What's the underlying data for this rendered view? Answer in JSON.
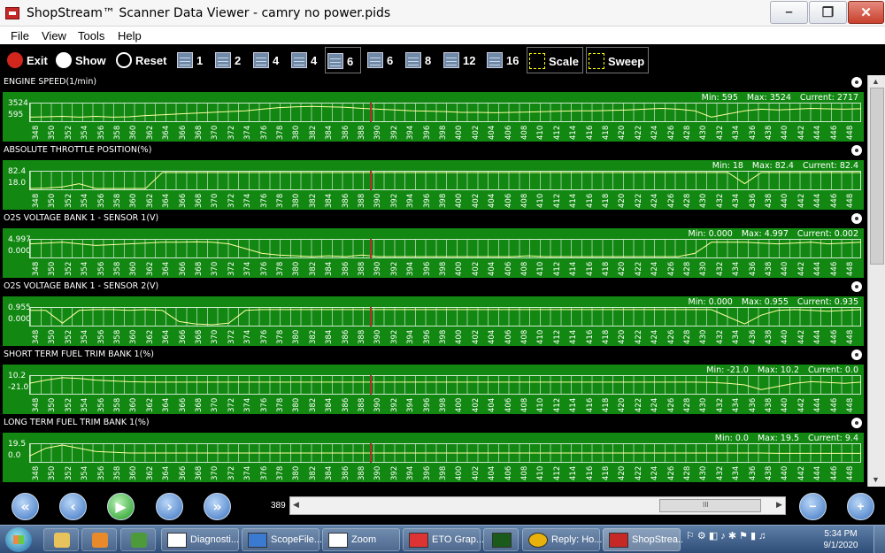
{
  "window": {
    "title": "ShopStream™ Scanner Data Viewer - camry no power.pids"
  },
  "menu": [
    "File",
    "View",
    "Tools",
    "Help"
  ],
  "toolbar": {
    "exit": "Exit",
    "show": "Show",
    "reset": "Reset",
    "layouts": [
      "1",
      "2",
      "4",
      "4",
      "6",
      "6",
      "8",
      "12",
      "16"
    ],
    "scale": "Scale",
    "sweep": "Sweep"
  },
  "x_ticks": [
    "348",
    "350",
    "352",
    "354",
    "356",
    "358",
    "360",
    "362",
    "364",
    "366",
    "368",
    "370",
    "372",
    "374",
    "376",
    "378",
    "380",
    "382",
    "384",
    "386",
    "388",
    "390",
    "392",
    "394",
    "396",
    "398",
    "400",
    "402",
    "404",
    "406",
    "408",
    "410",
    "412",
    "414",
    "416",
    "418",
    "420",
    "422",
    "424",
    "426",
    "428",
    "430",
    "432",
    "434",
    "436",
    "438",
    "440",
    "442",
    "444",
    "446",
    "448"
  ],
  "panels": [
    {
      "title": "ENGINE SPEED(1/min)",
      "min_label": "Min: 595",
      "max_label": "Max: 3524",
      "current_label": "Current: 2717",
      "ymax": "3524",
      "ymin": "595",
      "trace": [
        0.2,
        0.22,
        0.25,
        0.2,
        0.25,
        0.2,
        0.22,
        0.3,
        0.35,
        0.4,
        0.45,
        0.5,
        0.55,
        0.6,
        0.7,
        0.8,
        0.85,
        0.88,
        0.85,
        0.82,
        0.75,
        0.7,
        0.65,
        0.6,
        0.58,
        0.55,
        0.5,
        0.5,
        0.48,
        0.5,
        0.52,
        0.55,
        0.58,
        0.6,
        0.6,
        0.62,
        0.65,
        0.7,
        0.75,
        0.7,
        0.6,
        0.2,
        0.4,
        0.6,
        0.7,
        0.65,
        0.7,
        0.75,
        0.72,
        0.7,
        0.73
      ]
    },
    {
      "title": "ABSOLUTE THROTTLE POSITION(%)",
      "min_label": "Min: 18",
      "max_label": "Max: 82.4",
      "current_label": "Current: 82.4",
      "ymax": "82.4",
      "ymin": "18.0",
      "trace": [
        0,
        0.02,
        0.1,
        0.3,
        0,
        0,
        0,
        0,
        1,
        1,
        1,
        1,
        1,
        1,
        1,
        1,
        1,
        1,
        1,
        1,
        1,
        1,
        1,
        1,
        1,
        1,
        1,
        1,
        1,
        1,
        1,
        1,
        1,
        1,
        1,
        1,
        1,
        1,
        1,
        1,
        1,
        1,
        1,
        0.3,
        1,
        1,
        1,
        1,
        1,
        1,
        1
      ]
    },
    {
      "title": "O2S VOLTAGE BANK 1 - SENSOR 1(V)",
      "min_label": "Min: 0.000",
      "max_label": "Max: 4.997",
      "current_label": "Current: 0.002",
      "ymax": "4.997",
      "ymin": "0.000",
      "trace": [
        0.8,
        0.85,
        0.9,
        0.8,
        0.7,
        0.75,
        0.8,
        0.85,
        0.9,
        0.9,
        0.92,
        0.9,
        0.8,
        0.5,
        0.2,
        0.1,
        0.05,
        0,
        0.05,
        0,
        0.1,
        0,
        0,
        0,
        0,
        0,
        0,
        0,
        0,
        0,
        0.05,
        0,
        0,
        0,
        0,
        0,
        0,
        0,
        0,
        0,
        0.2,
        0.9,
        0.9,
        0.9,
        0.85,
        0.8,
        0.85,
        0.9,
        0.8,
        0.85,
        0.9
      ]
    },
    {
      "title": "O2S VOLTAGE BANK 1 - SENSOR 2(V)",
      "min_label": "Min: 0.000",
      "max_label": "Max: 0.955",
      "current_label": "Current: 0.935",
      "ymax": "0.955",
      "ymin": "0.000",
      "trace": [
        0.9,
        0.9,
        0.1,
        0.9,
        0.95,
        0.95,
        0.9,
        0.95,
        0.9,
        0.2,
        0.05,
        0,
        0.1,
        0.9,
        0.95,
        0.95,
        0.95,
        0.95,
        0.95,
        0.95,
        0.95,
        0.95,
        0.95,
        0.95,
        0.95,
        0.95,
        0.95,
        0.95,
        0.95,
        0.95,
        0.95,
        0.95,
        0.95,
        0.95,
        0.95,
        0.95,
        0.95,
        0.95,
        0.95,
        0.95,
        0.95,
        0.95,
        0.5,
        0.05,
        0.6,
        0.9,
        0.95,
        0.9,
        0.85,
        0.9,
        0.95
      ]
    },
    {
      "title": "SHORT TERM FUEL TRIM BANK 1(%)",
      "min_label": "Min: -21.0",
      "max_label": "Max: 10.2",
      "current_label": "Current: 0.0",
      "ymax": "10.2",
      "ymin": "-21.0",
      "trace": [
        0.6,
        0.8,
        0.95,
        0.9,
        0.8,
        0.75,
        0.7,
        0.68,
        0.67,
        0.67,
        0.67,
        0.67,
        0.67,
        0.67,
        0.67,
        0.67,
        0.67,
        0.67,
        0.67,
        0.67,
        0.67,
        0.67,
        0.67,
        0.67,
        0.67,
        0.67,
        0.67,
        0.67,
        0.67,
        0.67,
        0.67,
        0.67,
        0.67,
        0.67,
        0.67,
        0.67,
        0.67,
        0.67,
        0.67,
        0.67,
        0.67,
        0.65,
        0.6,
        0.5,
        0.2,
        0.4,
        0.6,
        0.7,
        0.65,
        0.6,
        0.67
      ]
    },
    {
      "title": "LONG TERM FUEL TRIM BANK 1(%)",
      "min_label": "Min: 0.0",
      "max_label": "Max: 19.5",
      "current_label": "Current: 9.4",
      "ymax": "19.5",
      "ymin": "0.0",
      "trace": [
        0.3,
        0.8,
        1,
        0.8,
        0.6,
        0.55,
        0.5,
        0.5,
        0.5,
        0.5,
        0.5,
        0.5,
        0.5,
        0.5,
        0.5,
        0.5,
        0.5,
        0.5,
        0.5,
        0.5,
        0.5,
        0.5,
        0.5,
        0.5,
        0.5,
        0.5,
        0.5,
        0.5,
        0.5,
        0.5,
        0.5,
        0.5,
        0.5,
        0.5,
        0.5,
        0.5,
        0.5,
        0.5,
        0.5,
        0.5,
        0.5,
        0.5,
        0.5,
        0.5,
        0.5,
        0.48,
        0.48,
        0.48,
        0.48,
        0.48,
        0.48
      ]
    }
  ],
  "position": "389",
  "taskbar": {
    "tasks": [
      "Diagnosti...",
      "ScopeFile...",
      "Zoom",
      "ETO Grap...",
      "",
      "Reply: Ho...",
      "ShopStrea..."
    ],
    "time": "5:34 PM",
    "date": "9/1/2020"
  },
  "colors": {
    "plot_bg": "#128812",
    "trace": "#ffffa0",
    "cursor": "#b03030"
  }
}
